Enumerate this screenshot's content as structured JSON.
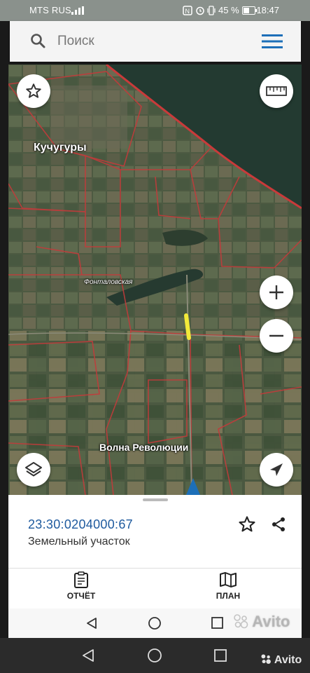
{
  "status_bar": {
    "carrier": "MTS RUS",
    "indicators": "45 %",
    "time": "18:47"
  },
  "search": {
    "placeholder": "Поиск"
  },
  "map": {
    "labels": {
      "village_1": "Кучугуры",
      "river": "Фонталовская",
      "village_2": "Волна Революции"
    }
  },
  "parcel": {
    "cadastral_number": "23:30:0204000:67",
    "type": "Земельный участок"
  },
  "bottom_nav": {
    "report_label": "ОТЧЁТ",
    "plan_label": "ПЛАН"
  },
  "watermark": {
    "text": "Avito"
  }
}
